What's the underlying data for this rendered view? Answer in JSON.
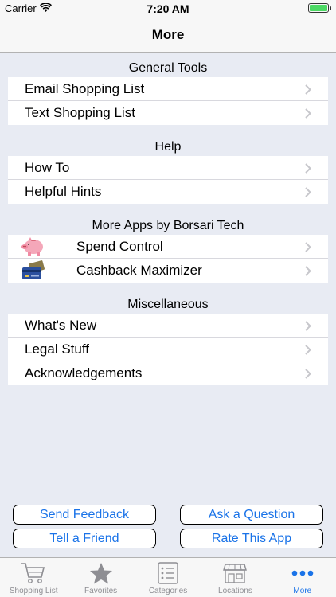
{
  "status_bar": {
    "carrier": "Carrier",
    "time": "7:20 AM"
  },
  "nav": {
    "title": "More"
  },
  "sections": {
    "general": {
      "header": "General Tools",
      "items": [
        "Email Shopping List",
        "Text Shopping List"
      ]
    },
    "help": {
      "header": "Help",
      "items": [
        "How To",
        "Helpful Hints"
      ]
    },
    "apps": {
      "header": "More Apps by Borsari Tech",
      "items": [
        "Spend Control",
        "Cashback Maximizer"
      ]
    },
    "misc": {
      "header": "Miscellaneous",
      "items": [
        "What's New",
        "Legal Stuff",
        "Acknowledgements"
      ]
    }
  },
  "buttons": {
    "send_feedback": "Send Feedback",
    "ask_question": "Ask a Question",
    "tell_friend": "Tell a Friend",
    "rate_app": "Rate This App"
  },
  "tabs": [
    {
      "label": "Shopping List",
      "icon": "cart-icon"
    },
    {
      "label": "Favorites",
      "icon": "star-icon"
    },
    {
      "label": "Categories",
      "icon": "list-icon"
    },
    {
      "label": "Locations",
      "icon": "store-icon"
    },
    {
      "label": "More",
      "icon": "more-icon",
      "active": true
    }
  ],
  "colors": {
    "accent": "#1a73e8",
    "background": "#e8ebf3",
    "battery": "#4cd964"
  }
}
